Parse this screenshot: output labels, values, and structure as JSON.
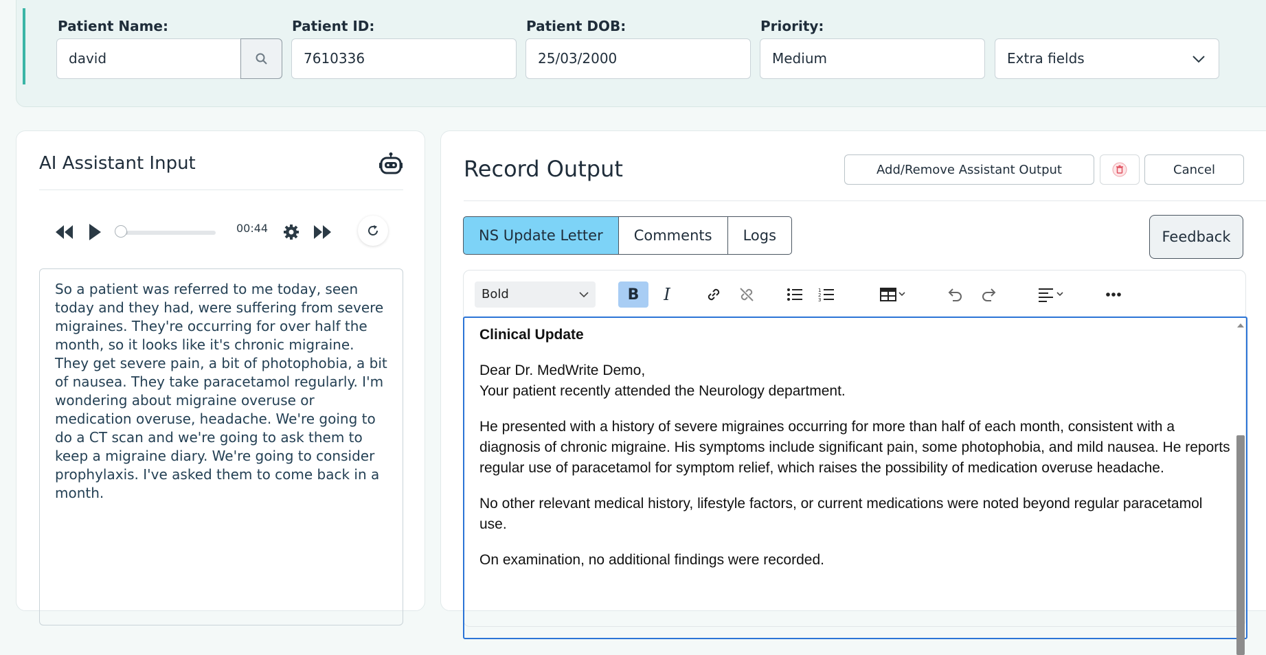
{
  "patient": {
    "name_label": "Patient Name:",
    "name_value": "david",
    "id_label": "Patient ID:",
    "id_value": "7610336",
    "dob_label": "Patient DOB:",
    "dob_value": "25/03/2000",
    "priority_label": "Priority:",
    "priority_value": "Medium",
    "extra_fields": "Extra fields"
  },
  "assistant": {
    "title": "AI Assistant Input",
    "time": "00:44",
    "transcript": "So a patient was referred to me today, seen today and they had, were suffering from severe migraines. They're occurring for over half the month, so it looks like it's chronic migraine. They get severe pain, a bit of photophobia, a bit of nausea. They take paracetamol regularly. I'm wondering about migraine overuse or medication overuse, headache. We're going to do a CT scan and we're going to ask them to keep a migraine diary. We're going to consider prophylaxis. I've asked them to come back in a month.",
    "playback_progress": 0.12
  },
  "record": {
    "title": "Record Output",
    "add_remove_label": "Add/Remove Assistant Output",
    "cancel_label": "Cancel",
    "tabs": [
      "NS Update Letter",
      "Comments",
      "Logs"
    ],
    "feedback_label": "Feedback",
    "format_select": "Bold"
  },
  "letter": {
    "heading": "Clinical Update",
    "salutation": "Dear Dr. MedWrite Demo,",
    "intro": "Your patient recently attended the Neurology department.",
    "p1": "He presented with a history of severe migraines occurring for more than half of each month, consistent with a diagnosis of chronic migraine. His symptoms include significant pain, some photophobia, and mild nausea. He reports regular use of paracetamol for symptom relief, which raises the possibility of medication overuse headache.",
    "p2": "No other relevant medical history, lifestyle factors, or current medications were noted beyond regular paracetamol use.",
    "p3": "On examination, no additional findings were recorded."
  },
  "colors": {
    "accent": "#3bb5a6",
    "active_tab": "#7dd3f7",
    "editor_border": "#2b74d6"
  }
}
